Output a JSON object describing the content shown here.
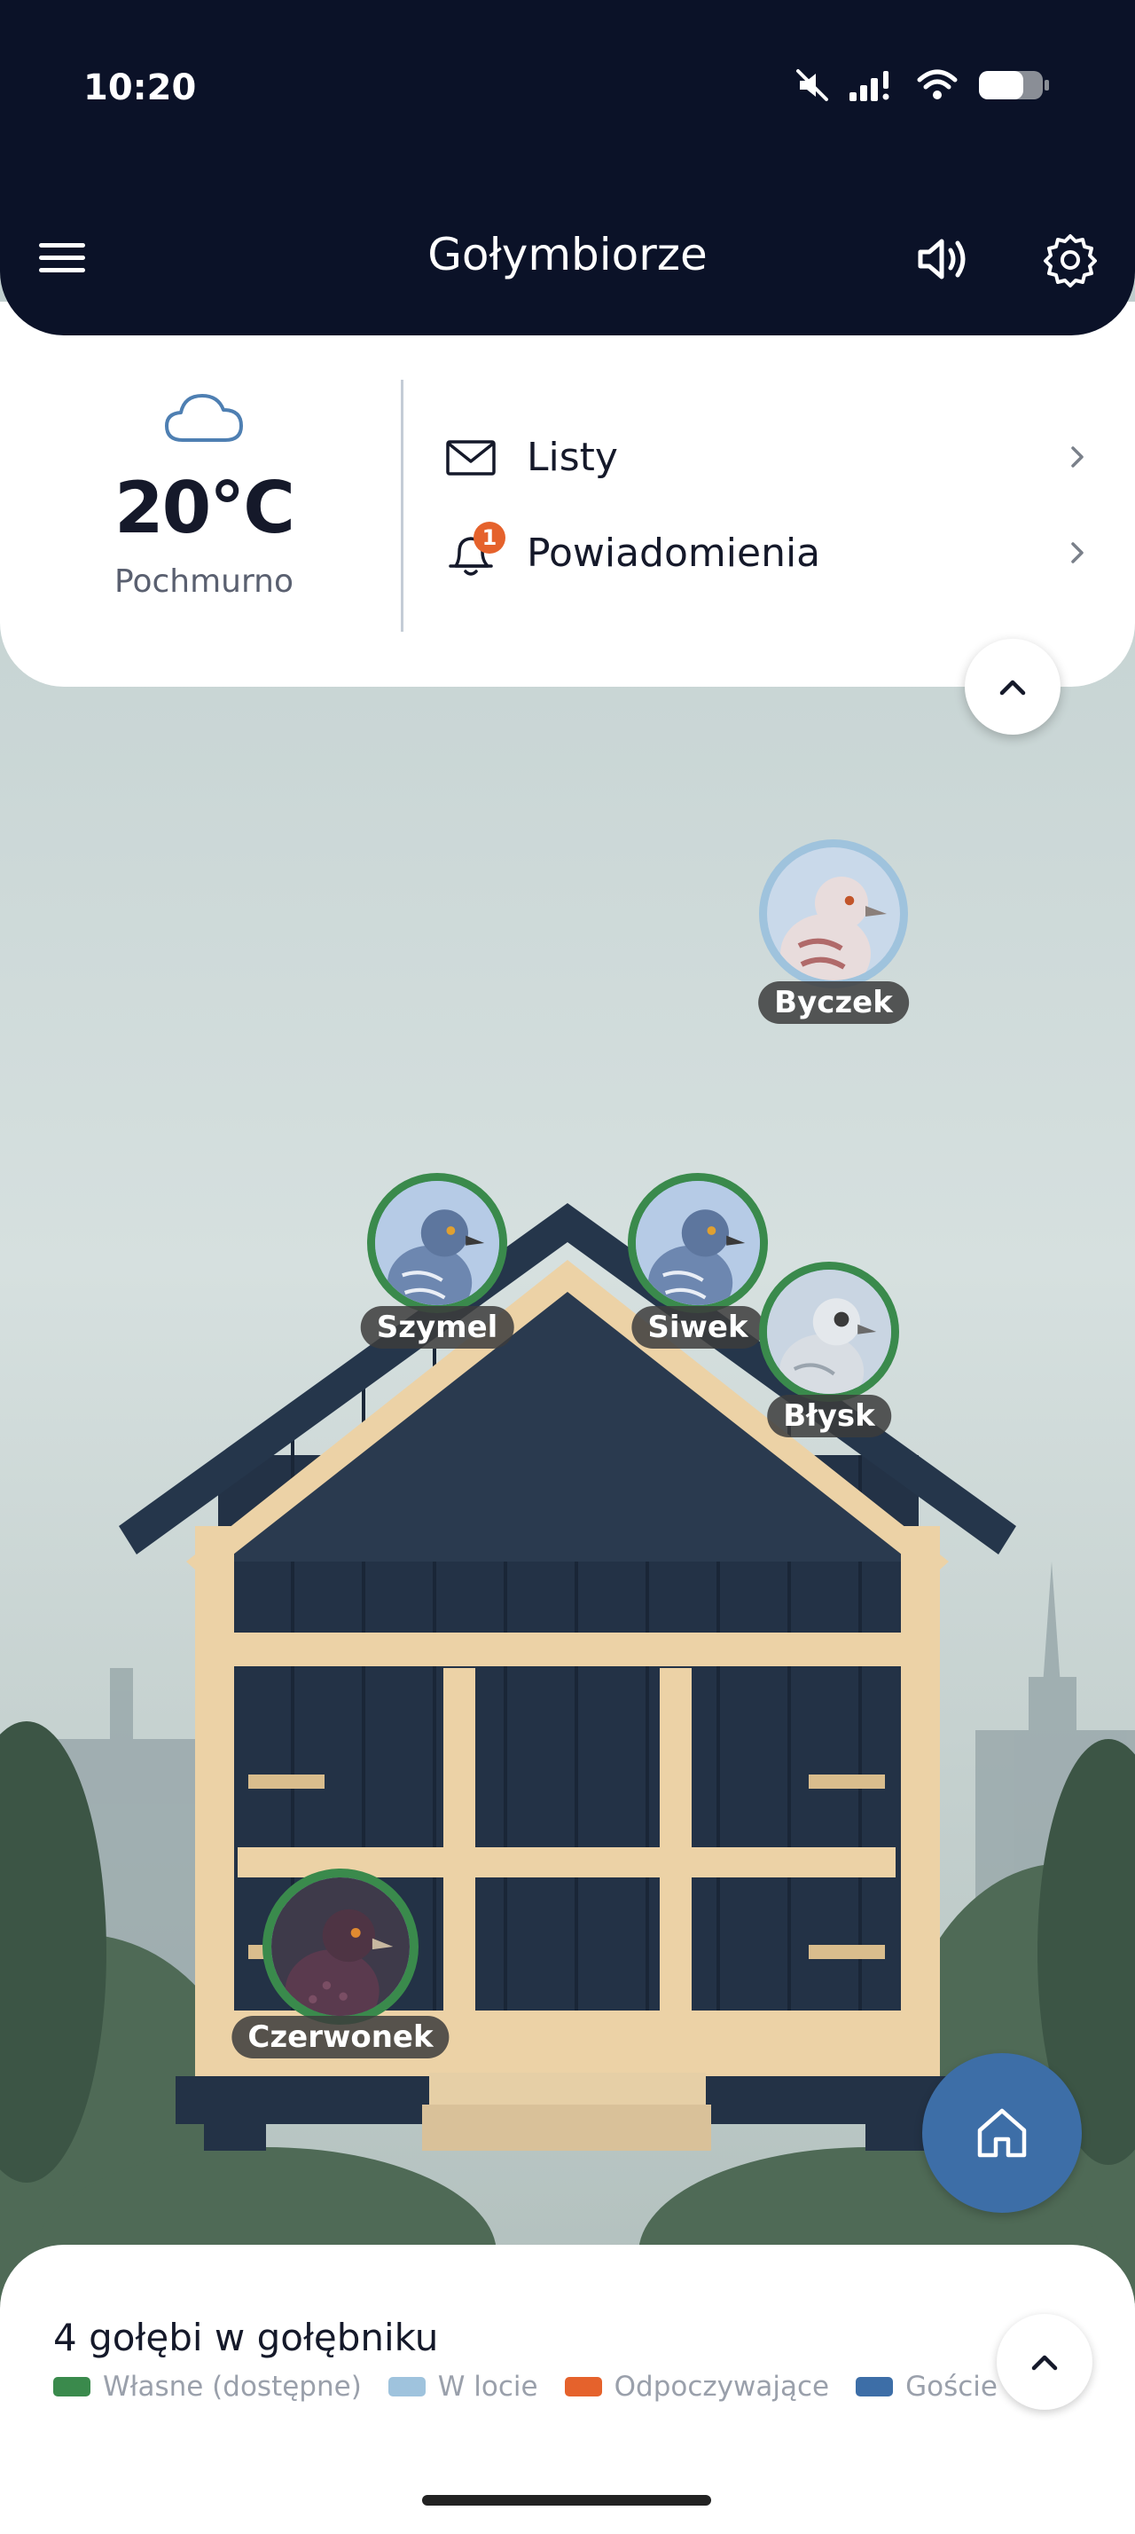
{
  "status_bar": {
    "time": "10:20"
  },
  "header": {
    "title": "Gołymbiorze"
  },
  "weather": {
    "temperature": "20°C",
    "condition": "Pochmurno",
    "icon": "cloud-icon"
  },
  "menu_items": [
    {
      "label": "Listy",
      "icon": "mail-icon"
    },
    {
      "label": "Powiadomienia",
      "icon": "bell-icon",
      "badge": "1"
    }
  ],
  "pigeons": [
    {
      "name": "Byczek",
      "status": "W locie",
      "ring_color": "#9fc3dd",
      "plumage": "#e8dcdc"
    },
    {
      "name": "Szymel",
      "status": "Własne (dostępne)",
      "ring_color": "#3a8a4c",
      "plumage": "#6d87b0"
    },
    {
      "name": "Siwek",
      "status": "Własne (dostępne)",
      "ring_color": "#3a8a4c",
      "plumage": "#6d87b0"
    },
    {
      "name": "Błysk",
      "status": "Własne (dostępne)",
      "ring_color": "#3a8a4c",
      "plumage": "#d8dde3"
    },
    {
      "name": "Czerwonek",
      "status": "Własne (dostępne)",
      "ring_color": "#3a8a4c",
      "plumage": "#5a3a4e"
    }
  ],
  "summary": {
    "count_text": "4 gołębi w gołębniku"
  },
  "legend": [
    {
      "label": "Własne (dostępne)",
      "color": "#3a8a4c"
    },
    {
      "label": "W locie",
      "color": "#9fc3dd"
    },
    {
      "label": "Odpoczywające",
      "color": "#e5622c"
    },
    {
      "label": "Goście",
      "color": "#3d6ea7"
    }
  ],
  "colors": {
    "header_bg": "#0b1228",
    "accent_blue": "#3d6ea7",
    "badge_orange": "#e5622c"
  }
}
